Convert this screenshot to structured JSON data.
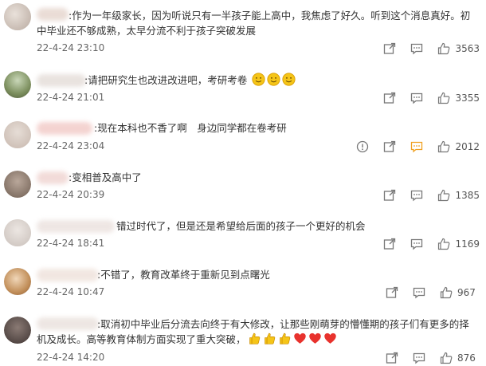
{
  "comments": [
    {
      "text": ":作为一年级家长，因为听说只有一半孩子能上高中，我焦虑了好久。听到这个消息真好。初中毕业还不够成熟，太早分流不利于孩子突破发展",
      "date": "22-4-24 23:10",
      "likes": "3563"
    },
    {
      "text": ":请把研究生也改进改进吧，考研考卷",
      "date": "22-4-24 21:01",
      "likes": "3355"
    },
    {
      "text": ":现在本科也不香了啊　身边同学都在卷考研",
      "date": "22-4-24 23:04",
      "likes": "2012"
    },
    {
      "text": ":变相普及高中了",
      "date": "22-4-24 20:39",
      "likes": "1385"
    },
    {
      "text": "错过时代了，但是还是希望给后面的孩子一个更好的机会",
      "date": "22-4-24 18:41",
      "likes": "1169"
    },
    {
      "text": ":不错了，教育改革终于重新见到点曙光",
      "date": "22-4-24 10:47",
      "likes": "967"
    },
    {
      "text": ":取消初中毕业后分流去向终于有大修改，让那些刚萌芽的懵懂期的孩子们有更多的择机及成长。高等教育体制方面实现了重大突破，",
      "date": "22-4-24 14:20",
      "likes": "876"
    }
  ],
  "emoji": {
    "c2": [
      "smile-emoji",
      "smile-emoji",
      "smile-emoji"
    ],
    "c7": [
      "thumbs-up-emoji",
      "thumbs-up-emoji",
      "thumbs-up-emoji",
      "heart-emoji",
      "heart-emoji",
      "heart-emoji"
    ]
  },
  "icons": {
    "report": "report-icon",
    "share": "share-icon",
    "reply": "comment-icon",
    "like": "like-icon"
  },
  "colors": {
    "text": "#333333",
    "meta": "#666666",
    "reply_highlight": "#f0a020",
    "emoji_face": "#f5c518",
    "heart": "#e8322d"
  }
}
